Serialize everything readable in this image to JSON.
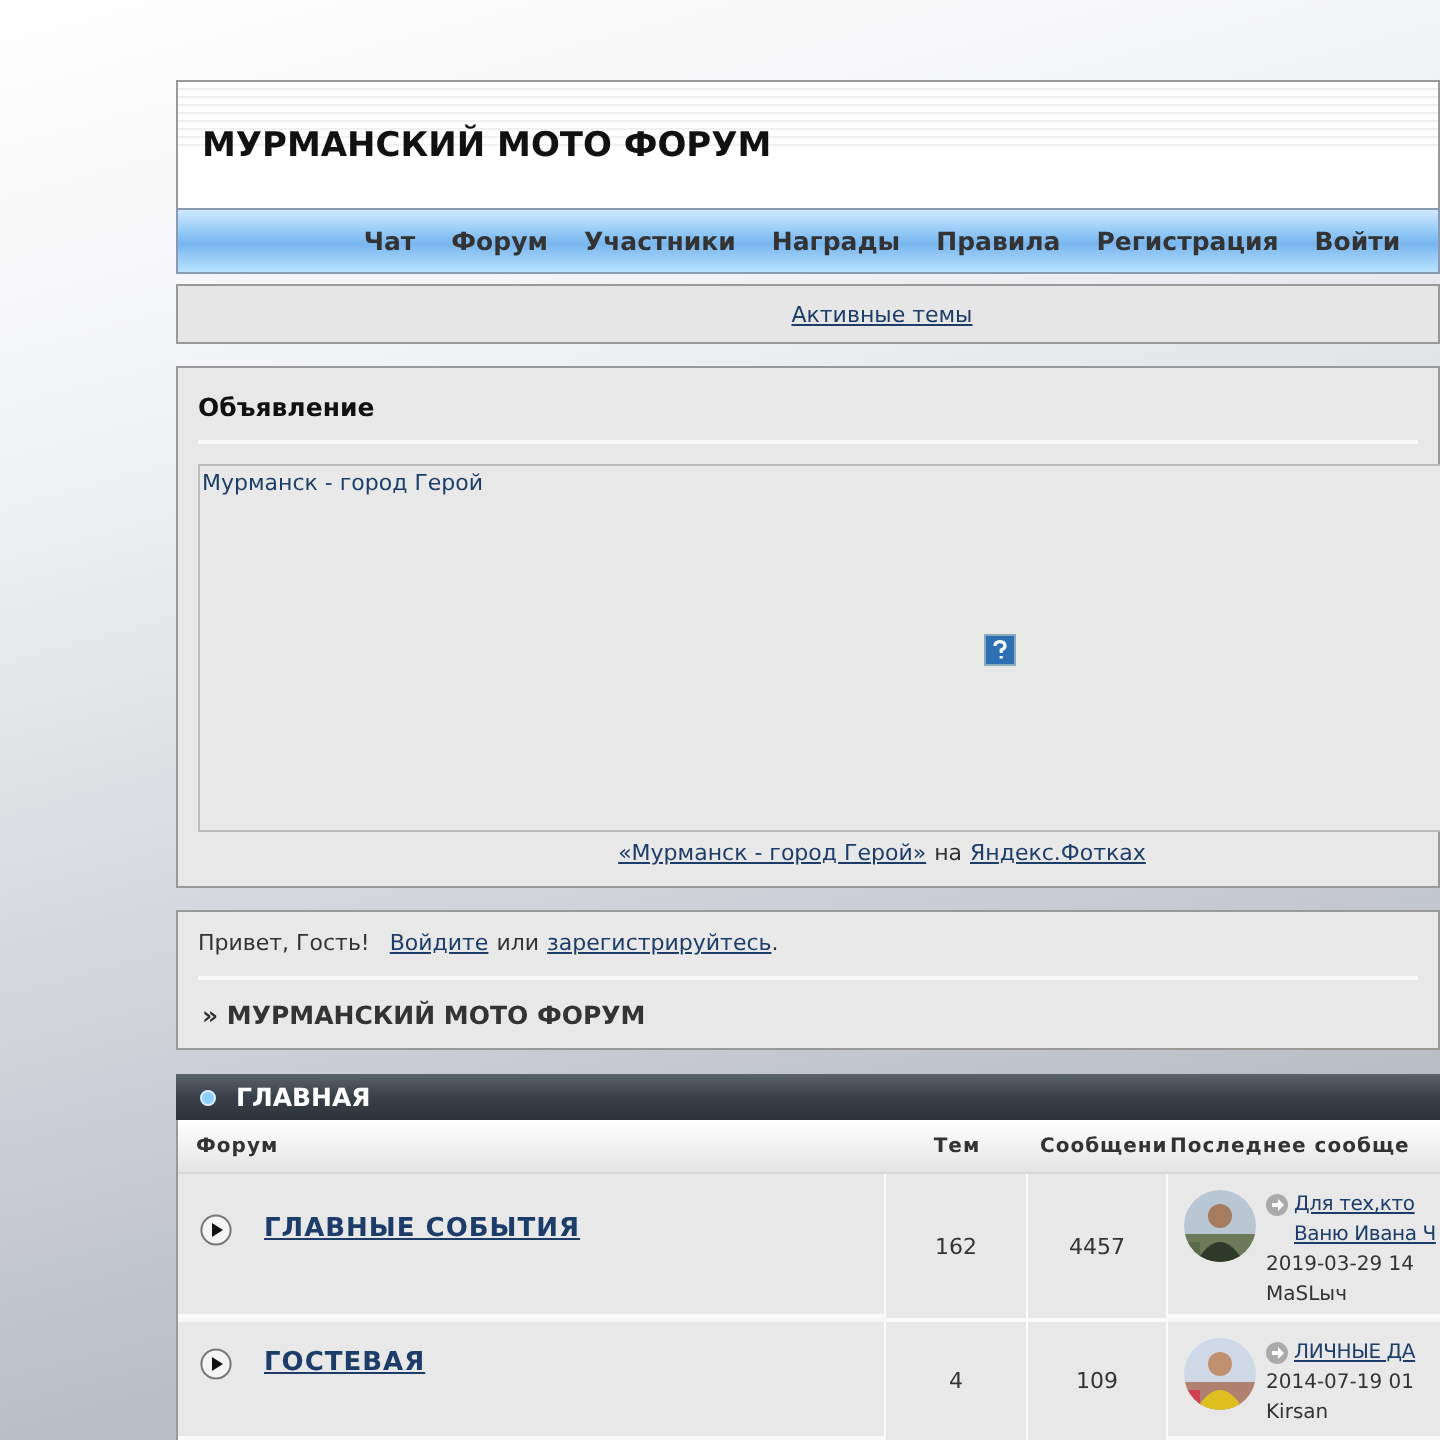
{
  "site_title": "МУРМАНСКИЙ МОТО ФОРУМ",
  "nav": [
    "Чат",
    "Форум",
    "Участники",
    "Награды",
    "Правила",
    "Регистрация",
    "Войти"
  ],
  "active_topics": "Активные темы",
  "announcement": {
    "title": "Объявление",
    "embed_title": "Мурманск - город Герой",
    "caption_link": "«Мурманск - город Герой»",
    "caption_middle": "на",
    "caption_site": "Яндекс.Фотках"
  },
  "welcome": {
    "greeting": "Привет, Гость!",
    "login": "Войдите",
    "or": "или",
    "register": "зарегистрируйтесь",
    "end": "."
  },
  "breadcrumb": "» МУРМАНСКИЙ МОТО ФОРУМ",
  "category": {
    "title": "ГЛАВНАЯ",
    "columns": [
      "Форум",
      "Тем",
      "Сообщени",
      "Последнее сообще"
    ],
    "rows": [
      {
        "name": "ГЛАВНЫЕ СОБЫТИЯ",
        "topics": "162",
        "posts": "4457",
        "last_topic_lines": [
          "Для тех,кто",
          "Ваню Ивана Ч"
        ],
        "date": "2019-03-29 14",
        "user": "MaSLыч"
      },
      {
        "name": "ГОСТЕВАЯ",
        "topics": "4",
        "posts": "109",
        "last_topic_lines": [
          "ЛИЧНЫЕ ДА"
        ],
        "date": "2014-07-19 01",
        "user": "Kirsan"
      }
    ]
  }
}
